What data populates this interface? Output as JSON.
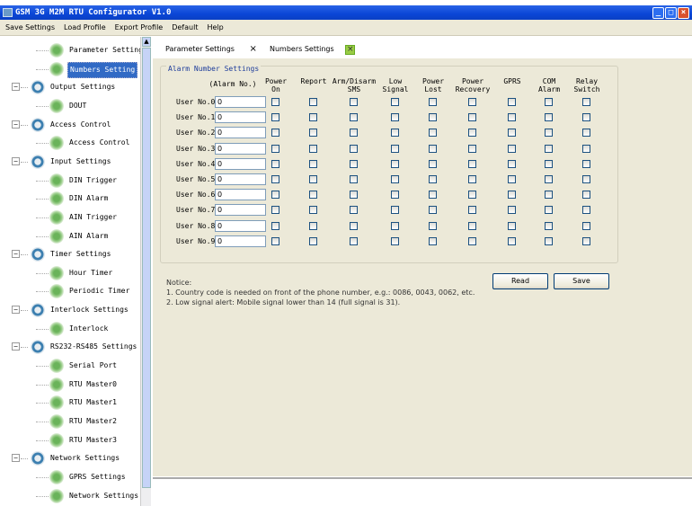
{
  "window": {
    "title": "GSM 3G M2M RTU Configurator V1.0"
  },
  "menu": [
    "Save Settings",
    "Load Profile",
    "Export Profile",
    "Default",
    "Help"
  ],
  "tree": [
    {
      "label": "Parameter Setting",
      "child": true
    },
    {
      "label": "Numbers Setting",
      "child": true,
      "selected": true
    },
    {
      "label": "Output Settings",
      "child": false
    },
    {
      "label": "DOUT",
      "child": true
    },
    {
      "label": "Access Control",
      "child": false
    },
    {
      "label": "Access Control",
      "child": true
    },
    {
      "label": "Input Settings",
      "child": false
    },
    {
      "label": "DIN Trigger",
      "child": true
    },
    {
      "label": "DIN Alarm",
      "child": true
    },
    {
      "label": "AIN Trigger",
      "child": true
    },
    {
      "label": "AIN Alarm",
      "child": true
    },
    {
      "label": "Timer Settings",
      "child": false
    },
    {
      "label": "Hour Timer",
      "child": true
    },
    {
      "label": "Periodic Timer",
      "child": true
    },
    {
      "label": "Interlock Settings",
      "child": false
    },
    {
      "label": "Interlock",
      "child": true
    },
    {
      "label": "RS232-RS485 Settings",
      "child": false
    },
    {
      "label": "Serial Port",
      "child": true
    },
    {
      "label": "RTU Master0",
      "child": true
    },
    {
      "label": "RTU Master1",
      "child": true
    },
    {
      "label": "RTU Master2",
      "child": true
    },
    {
      "label": "RTU Master3",
      "child": true
    },
    {
      "label": "Network Settings",
      "child": false
    },
    {
      "label": "GPRS Settings",
      "child": true
    },
    {
      "label": "Network Settings",
      "child": true
    }
  ],
  "tabs": [
    {
      "label": "Parameter Settings",
      "close": "×"
    },
    {
      "label": "Numbers Settings",
      "close": "×"
    }
  ],
  "group": {
    "label": "Alarm Number Settings"
  },
  "columns": [
    "(Alarm No.)",
    "Power\nOn",
    "Report",
    "Arm/Disarm\nSMS",
    "Low\nSignal",
    "Power\nLost",
    "Power\nRecovery",
    "GPRS",
    "COM\nAlarm",
    "Relay\nSwitch"
  ],
  "users": [
    {
      "label": "User No.0",
      "value": "0"
    },
    {
      "label": "User No.1",
      "value": "0"
    },
    {
      "label": "User No.2",
      "value": "0"
    },
    {
      "label": "User No.3",
      "value": "0"
    },
    {
      "label": "User No.4",
      "value": "0"
    },
    {
      "label": "User No.5",
      "value": "0"
    },
    {
      "label": "User No.6",
      "value": "0"
    },
    {
      "label": "User No.7",
      "value": "0"
    },
    {
      "label": "User No.8",
      "value": "0"
    },
    {
      "label": "User No.9",
      "value": "0"
    }
  ],
  "buttons": {
    "read": "Read",
    "save": "Save"
  },
  "notice": [
    "Notice:",
    "1. Country code is needed on front of the phone number, e.g.: 0086, 0043, 0062, etc.",
    "2. Low signal alert: Mobile signal lower than 14 (full signal is 31)."
  ]
}
